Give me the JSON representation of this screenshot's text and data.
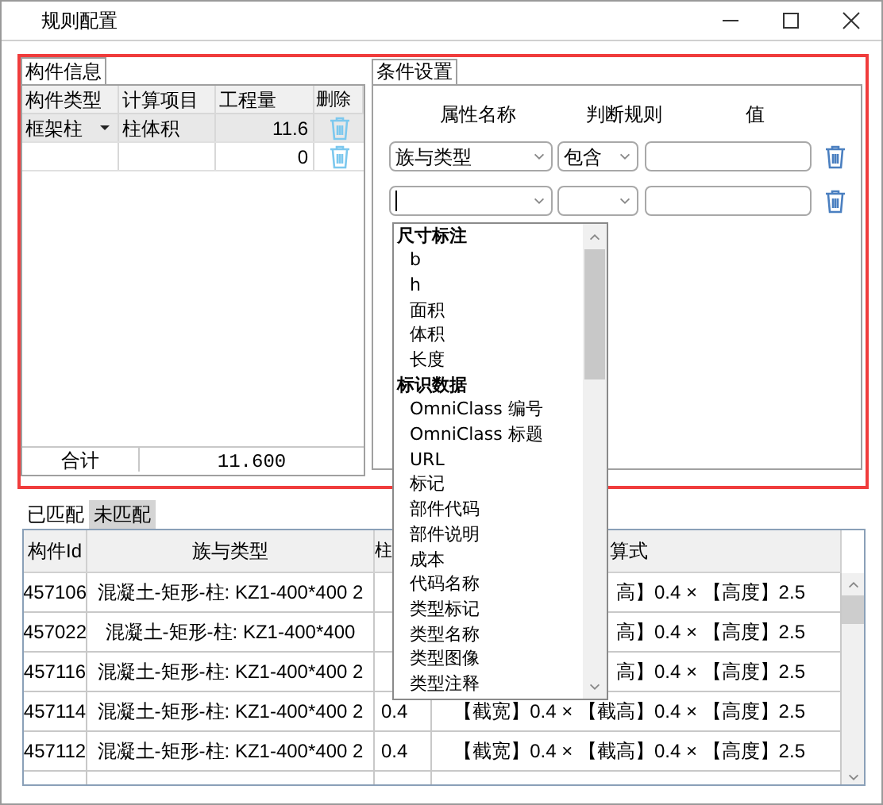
{
  "window": {
    "title": "规则配置"
  },
  "component_info": {
    "tab": "构件信息",
    "columns": [
      "构件类型",
      "计算项目",
      "工程量",
      "删除"
    ],
    "rows": [
      {
        "type": "框架柱",
        "item": "柱体积",
        "quantity": "11.6",
        "selected": true
      },
      {
        "quantity": "0",
        "selected": false
      }
    ],
    "total": {
      "label": "合计",
      "value": "11.600"
    }
  },
  "conditions": {
    "tab": "条件设置",
    "columns": [
      "属性名称",
      "判断规则",
      "值"
    ],
    "rows": [
      {
        "property": "族与类型",
        "rule": "包含",
        "focused": false
      },
      {
        "focused": true,
        "dropdown": {
          "items": [
            {
              "kind": "group",
              "label": "尺寸标注"
            },
            {
              "kind": "item",
              "label": "b"
            },
            {
              "kind": "item",
              "label": "h"
            },
            {
              "kind": "item",
              "label": "面积"
            },
            {
              "kind": "item",
              "label": "体积"
            },
            {
              "kind": "item",
              "label": "长度"
            },
            {
              "kind": "group",
              "label": "标识数据"
            },
            {
              "kind": "item",
              "label": "OmniClass 编号"
            },
            {
              "kind": "item",
              "label": "OmniClass 标题"
            },
            {
              "kind": "item",
              "label": "URL"
            },
            {
              "kind": "item",
              "label": "标记"
            },
            {
              "kind": "item",
              "label": "部件代码"
            },
            {
              "kind": "item",
              "label": "部件说明"
            },
            {
              "kind": "item",
              "label": "成本"
            },
            {
              "kind": "item",
              "label": "代码名称"
            },
            {
              "kind": "item",
              "label": "类型标记"
            },
            {
              "kind": "item",
              "label": "类型名称"
            },
            {
              "kind": "item",
              "label": "类型图像"
            },
            {
              "kind": "item",
              "label": "类型注释"
            }
          ]
        }
      }
    ]
  },
  "results": {
    "tabs": [
      {
        "label": "已匹配",
        "selected": false
      },
      {
        "label": "未匹配",
        "selected": true
      }
    ],
    "columns": [
      "构件Id",
      "族与类型",
      "柱",
      "算式"
    ],
    "rows": [
      {
        "id": "457106",
        "family_type": "混凝土-矩形-柱: KZ1-400*400 2",
        "formula": "高】0.4 × 【高度】2.5"
      },
      {
        "id": "457022",
        "family_type": "混凝土-矩形-柱: KZ1-400*400",
        "formula": "高】0.4 × 【高度】2.5"
      },
      {
        "id": "457116",
        "family_type": "混凝土-矩形-柱: KZ1-400*400 2",
        "formula": "高】0.4 × 【高度】2.5"
      },
      {
        "id": "457114",
        "family_type": "混凝土-矩形-柱: KZ1-400*400 2",
        "column_3": "0.4",
        "formula": "【截宽】0.4 × 【截高】0.4 × 【高度】2.5"
      },
      {
        "id": "457112",
        "family_type": "混凝土-矩形-柱: KZ1-400*400 2",
        "column_3": "0.4",
        "formula": "【截宽】0.4 × 【截高】0.4 × 【高度】2.5"
      }
    ]
  }
}
